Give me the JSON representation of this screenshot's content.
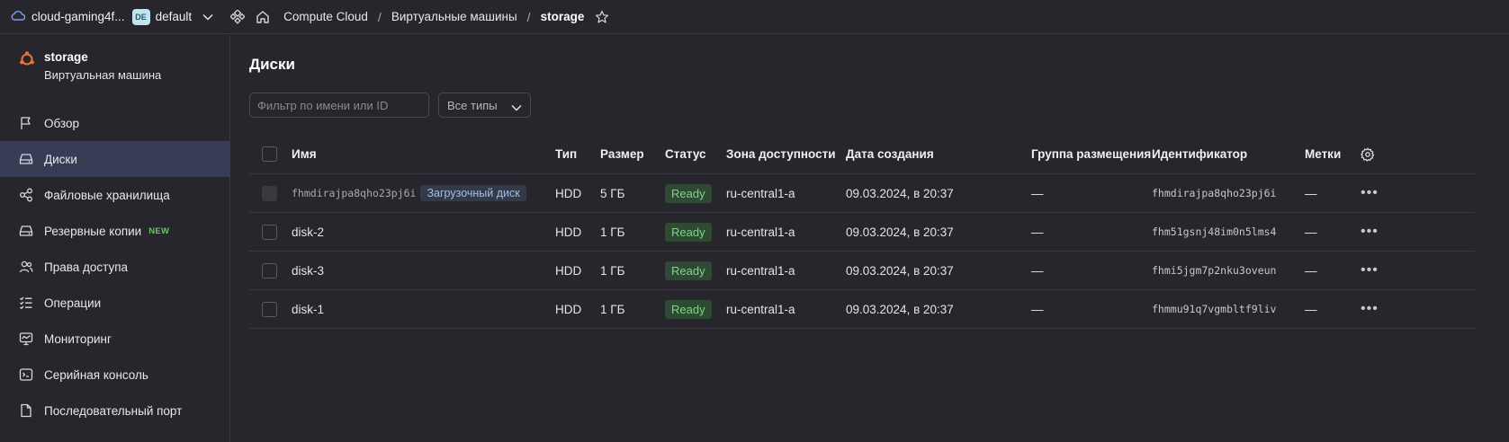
{
  "topbar": {
    "cloud_name": "cloud-gaming4f...",
    "folder_badge": "DE",
    "folder_name": "default",
    "breadcrumbs": [
      "Compute Cloud",
      "Виртуальные машины",
      "storage"
    ],
    "breadcrumb_separator": "/"
  },
  "sidebar": {
    "resource_name": "storage",
    "resource_type": "Виртуальная машина",
    "items": [
      {
        "label": "Обзор",
        "icon": "flag-icon",
        "active": false
      },
      {
        "label": "Диски",
        "icon": "disk-icon",
        "active": true
      },
      {
        "label": "Файловые хранилища",
        "icon": "share-icon",
        "active": false
      },
      {
        "label": "Резервные копии",
        "icon": "backup-icon",
        "active": false,
        "badge": "NEW"
      },
      {
        "label": "Права доступа",
        "icon": "users-icon",
        "active": false
      },
      {
        "label": "Операции",
        "icon": "list-check-icon",
        "active": false
      },
      {
        "label": "Мониторинг",
        "icon": "monitor-icon",
        "active": false
      },
      {
        "label": "Серийная консоль",
        "icon": "terminal-icon",
        "active": false
      },
      {
        "label": "Последовательный порт",
        "icon": "file-icon",
        "active": false
      }
    ]
  },
  "main": {
    "title": "Диски",
    "filter_placeholder": "Фильтр по имени или ID",
    "type_select": "Все типы",
    "columns": {
      "name": "Имя",
      "type": "Тип",
      "size": "Размер",
      "status": "Статус",
      "zone": "Зона доступности",
      "created": "Дата создания",
      "group": "Группа размещения",
      "id": "Идентификатор",
      "labels": "Метки"
    },
    "rows": [
      {
        "name": "fhmdirajpa8qho23pj6i",
        "boot_tag": "Загрузочный диск",
        "type": "HDD",
        "size": "5 ГБ",
        "status": "Ready",
        "zone": "ru-central1-a",
        "created": "09.03.2024, в 20:37",
        "group": "—",
        "id": "fhmdirajpa8qho23pj6i",
        "labels": "—"
      },
      {
        "name": "disk-2",
        "type": "HDD",
        "size": "1 ГБ",
        "status": "Ready",
        "zone": "ru-central1-a",
        "created": "09.03.2024, в 20:37",
        "group": "—",
        "id": "fhm51gsnj48im0n5lms4",
        "labels": "—"
      },
      {
        "name": "disk-3",
        "type": "HDD",
        "size": "1 ГБ",
        "status": "Ready",
        "zone": "ru-central1-a",
        "created": "09.03.2024, в 20:37",
        "group": "—",
        "id": "fhmi5jgm7p2nku3oveun",
        "labels": "—"
      },
      {
        "name": "disk-1",
        "type": "HDD",
        "size": "1 ГБ",
        "status": "Ready",
        "zone": "ru-central1-a",
        "created": "09.03.2024, в 20:37",
        "group": "—",
        "id": "fhmmu91q7vgmbltf9liv",
        "labels": "—"
      }
    ],
    "actions_glyph": "•••"
  },
  "colors": {
    "background": "#27262c",
    "active_nav": "#363d54",
    "status_ready_bg": "#2e4a33",
    "status_ready_fg": "#7fd48a",
    "vm_icon": "#e8743b",
    "new_badge": "#6fbf6d"
  }
}
